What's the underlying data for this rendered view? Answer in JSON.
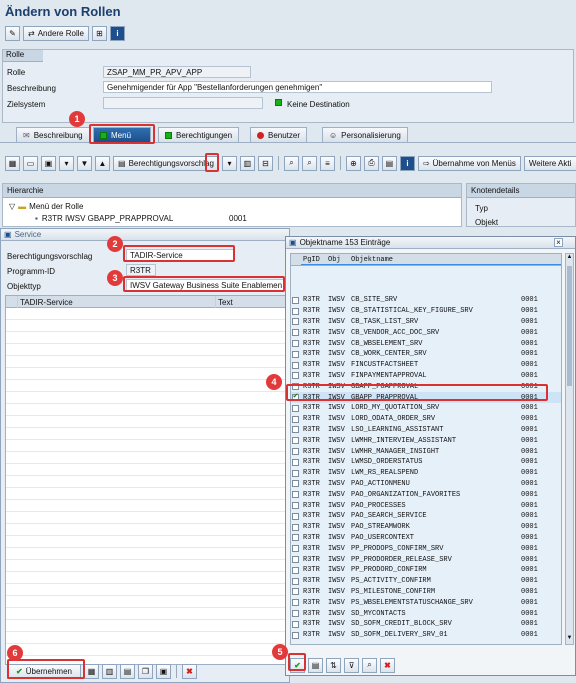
{
  "window": {
    "title": "Ändern von Rollen"
  },
  "toolbar": {
    "andere_rolle": "Andere Rolle"
  },
  "role_group": {
    "header": "Rolle",
    "fields": [
      {
        "label": "Rolle",
        "value": "ZSAP_MM_PR_APV_APP"
      },
      {
        "label": "Beschreibung",
        "value": "Genehmigender für App \"Bestellanforderungen genehmigen\""
      },
      {
        "label": "Zielsystem",
        "value": "",
        "status": "Keine Destination"
      }
    ]
  },
  "tabs": [
    {
      "label": "Beschreibung"
    },
    {
      "label": "Menü"
    },
    {
      "label": "Berechtigungen"
    },
    {
      "label": "Benutzer"
    },
    {
      "label": "Personalisierung"
    }
  ],
  "menu_toolbar": {
    "berechtigungsvorschlag": "Berechtigungsvorschlag",
    "uebernahme": "Übernahme von Menüs",
    "weitere": "Weitere Akti"
  },
  "hierarchy": {
    "header": "Hierarchie",
    "root": "Menü der Rolle",
    "item_name": "R3TR IWSV GBAPP_PRAPPROVAL",
    "item_version": "0001"
  },
  "knotendetails": {
    "header": "Knotendetails",
    "typ": "Typ",
    "objekt": "Objekt"
  },
  "service_dialog": {
    "title": "Service",
    "berechtigungsvorschlag_label": "Berechtigungsvorschlag",
    "berechtigungsvorschlag_value": "TADIR-Service",
    "programm_id_label": "Programm-ID",
    "programm_id_value": "R3TR",
    "objekttyp_label": "Objekttyp",
    "objekttyp_value": "IWSV Gateway Business Suite Enablemen",
    "table_headers": [
      "TADIR-Service",
      "Text"
    ],
    "uebernehmen": "Übernehmen"
  },
  "popup": {
    "title": "Objektname 153 Einträge",
    "headers": [
      "PgID",
      "Obj",
      "Objektname"
    ],
    "rows": [
      {
        "pgid": "R3TR",
        "obj": "IWSV",
        "name": "CB_SITE_SRV",
        "ver": "0001",
        "checked": false
      },
      {
        "pgid": "R3TR",
        "obj": "IWSV",
        "name": "CB_STATISTICAL_KEY_FIGURE_SRV",
        "ver": "0001",
        "checked": false
      },
      {
        "pgid": "R3TR",
        "obj": "IWSV",
        "name": "CB_TASK_LIST_SRV",
        "ver": "0001",
        "checked": false
      },
      {
        "pgid": "R3TR",
        "obj": "IWSV",
        "name": "CB_VENDOR_ACC_DOC_SRV",
        "ver": "0001",
        "checked": false
      },
      {
        "pgid": "R3TR",
        "obj": "IWSV",
        "name": "CB_WBSELEMENT_SRV",
        "ver": "0001",
        "checked": false
      },
      {
        "pgid": "R3TR",
        "obj": "IWSV",
        "name": "CB_WORK_CENTER_SRV",
        "ver": "0001",
        "checked": false
      },
      {
        "pgid": "R3TR",
        "obj": "IWSV",
        "name": "FINCUSTFACTSHEET",
        "ver": "0001",
        "checked": false
      },
      {
        "pgid": "R3TR",
        "obj": "IWSV",
        "name": "FINPAYMENTAPPROVAL",
        "ver": "0001",
        "checked": false
      },
      {
        "pgid": "R3TR",
        "obj": "IWSV",
        "name": "GBAPP_POAPPROVAL",
        "ver": "0001",
        "checked": false
      },
      {
        "pgid": "R3TR",
        "obj": "IWSV",
        "name": "GBAPP_PRAPPROVAL",
        "ver": "0001",
        "checked": true
      },
      {
        "pgid": "R3TR",
        "obj": "IWSV",
        "name": "LORD_MY_QUOTATION_SRV",
        "ver": "0001",
        "checked": false
      },
      {
        "pgid": "R3TR",
        "obj": "IWSV",
        "name": "LORD_ODATA_ORDER_SRV",
        "ver": "0001",
        "checked": false
      },
      {
        "pgid": "R3TR",
        "obj": "IWSV",
        "name": "LSO_LEARNING_ASSISTANT",
        "ver": "0001",
        "checked": false
      },
      {
        "pgid": "R3TR",
        "obj": "IWSV",
        "name": "LWMHR_INTERVIEW_ASSISTANT",
        "ver": "0001",
        "checked": false
      },
      {
        "pgid": "R3TR",
        "obj": "IWSV",
        "name": "LWMHR_MANAGER_INSIGHT",
        "ver": "0001",
        "checked": false
      },
      {
        "pgid": "R3TR",
        "obj": "IWSV",
        "name": "LWMSD_ORDERSTATUS",
        "ver": "0001",
        "checked": false
      },
      {
        "pgid": "R3TR",
        "obj": "IWSV",
        "name": "LWM_RS_REALSPEND",
        "ver": "0001",
        "checked": false
      },
      {
        "pgid": "R3TR",
        "obj": "IWSV",
        "name": "PAO_ACTIONMENU",
        "ver": "0001",
        "checked": false
      },
      {
        "pgid": "R3TR",
        "obj": "IWSV",
        "name": "PAO_ORGANIZATION_FAVORITES",
        "ver": "0001",
        "checked": false
      },
      {
        "pgid": "R3TR",
        "obj": "IWSV",
        "name": "PAO_PROCESSES",
        "ver": "0001",
        "checked": false
      },
      {
        "pgid": "R3TR",
        "obj": "IWSV",
        "name": "PAO_SEARCH_SERVICE",
        "ver": "0001",
        "checked": false
      },
      {
        "pgid": "R3TR",
        "obj": "IWSV",
        "name": "PAO_STREAMWORK",
        "ver": "0001",
        "checked": false
      },
      {
        "pgid": "R3TR",
        "obj": "IWSV",
        "name": "PAO_USERCONTEXT",
        "ver": "0001",
        "checked": false
      },
      {
        "pgid": "R3TR",
        "obj": "IWSV",
        "name": "PP_PRODOPS_CONFIRM_SRV",
        "ver": "0001",
        "checked": false
      },
      {
        "pgid": "R3TR",
        "obj": "IWSV",
        "name": "PP_PRODORDER_RELEASE_SRV",
        "ver": "0001",
        "checked": false
      },
      {
        "pgid": "R3TR",
        "obj": "IWSV",
        "name": "PP_PRODORD_CONFIRM",
        "ver": "0001",
        "checked": false
      },
      {
        "pgid": "R3TR",
        "obj": "IWSV",
        "name": "PS_ACTIVITY_CONFIRM",
        "ver": "0001",
        "checked": false
      },
      {
        "pgid": "R3TR",
        "obj": "IWSV",
        "name": "PS_MILESTONE_CONFIRM",
        "ver": "0001",
        "checked": false
      },
      {
        "pgid": "R3TR",
        "obj": "IWSV",
        "name": "PS_WBSELEMENTSTATUSCHANGE_SRV",
        "ver": "0001",
        "checked": false
      },
      {
        "pgid": "R3TR",
        "obj": "IWSV",
        "name": "SD_MYCONTACTS",
        "ver": "0001",
        "checked": false
      },
      {
        "pgid": "R3TR",
        "obj": "IWSV",
        "name": "SD_SOFM_CREDIT_BLOCK_SRV",
        "ver": "0001",
        "checked": false
      },
      {
        "pgid": "R3TR",
        "obj": "IWSV",
        "name": "SD_SOFM_DELIVERY_SRV_01",
        "ver": "0001",
        "checked": false
      }
    ]
  },
  "annotations": [
    "1",
    "2",
    "3",
    "4",
    "5",
    "6"
  ],
  "colors": {
    "annotation_red": "#d83232",
    "sap_blue": "#1d4f8c",
    "selected_row": "#cfe3f7"
  }
}
